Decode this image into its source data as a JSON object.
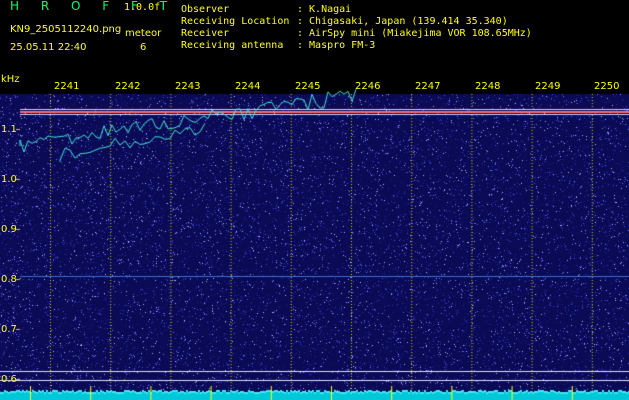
{
  "header": {
    "title": "H R O F F T",
    "version": "1.0.0f",
    "filename": "KN9_2505112240.png",
    "datetime": "25.05.11 22:40",
    "meteor_label": "meteor",
    "meteor_count": "6",
    "info_labels": [
      "Observer",
      "Receiving Location",
      "Receiver",
      "Receiving antenna"
    ],
    "info_values": [
      ": K.Nagai",
      ": Chigasaki, Japan (139.414 35.340)",
      ": AirSpy mini (Miakejima VOR 108.65MHz)",
      ": Maspro FM-3"
    ]
  },
  "axes": {
    "y_unit": "kHz",
    "x_ticks": [
      "2241",
      "2242",
      "2243",
      "2244",
      "2245",
      "2246",
      "2247",
      "2248",
      "2249",
      "2250"
    ],
    "y_ticks": [
      "1.1",
      "1.0",
      "0.9",
      "0.8",
      "0.7",
      "0.6"
    ]
  },
  "colors": {
    "text": "#ffff00",
    "title": "#00ff66",
    "background": "#000000",
    "noise": "#1a1a8a",
    "carrier": "#ff6060",
    "trace": "#40e0d0"
  }
}
